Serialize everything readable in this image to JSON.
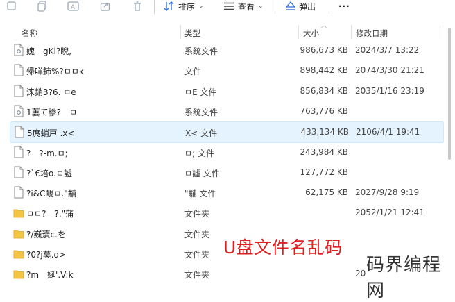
{
  "toolbar": {
    "sort_label": "排序",
    "view_label": "查看",
    "eject_label": "弹出",
    "more_label": "···"
  },
  "columns": {
    "name": "名称",
    "type": "类型",
    "size": "大小",
    "modified": "修改日期"
  },
  "files": [
    {
      "name": "媿　gKl?睨,",
      "type": "系统文件",
      "size": "986,673 KB",
      "date": "2024/3/7 13:22",
      "icon": "system-file-icon"
    },
    {
      "name": "帰咩鈰%?ㅁㅁk",
      "type": "文件",
      "size": "898,442 KB",
      "date": "2074/3/30 21:21",
      "icon": "file-icon"
    },
    {
      "name": "涞銷3?6. ㅁe",
      "type": "ㅁE 文件",
      "size": "856,834 KB",
      "date": "2035/1/16 23:19",
      "icon": "file-icon"
    },
    {
      "name": "1萋て椮?　ㅁ",
      "type": "系统文件",
      "size": "763,776 KB",
      "date": "",
      "icon": "system-file-icon"
    },
    {
      "name": "5庹蛸戸 .x<",
      "type": "X< 文件",
      "size": "433,134 KB",
      "date": "2106/4/1 19:41",
      "icon": "file-icon",
      "selected": true
    },
    {
      "name": "?　?-m.ㅁ;",
      "type": "ㅁ; 文件",
      "size": "243,984 KB",
      "date": "",
      "icon": "file-icon"
    },
    {
      "name": "?`€培o.ㅁ譃",
      "type": "ㅁ譃 文件",
      "size": "127,772 KB",
      "date": "",
      "icon": "file-icon"
    },
    {
      "name": "?i&C靦ㅁ.\"黼",
      "type": "\"黼 文件",
      "size": "62,175 KB",
      "date": "2027/9/28 9:19",
      "icon": "file-icon"
    },
    {
      "name": "ㅁㅁ?　?.\"蒲",
      "type": "文件夹",
      "size": "",
      "date": "2052/1/21 12:41",
      "icon": "folder-icon"
    },
    {
      "name": "?/巍瀆c.を",
      "type": "文件夹",
      "size": "",
      "date": "",
      "icon": "folder-icon"
    },
    {
      "name": "?0?j茣.d>",
      "type": "文件夹",
      "size": "",
      "date": "",
      "icon": "folder-icon"
    },
    {
      "name": "?m　娫'.V:k",
      "type": "文件夹",
      "size": "",
      "date": "20",
      "icon": "folder-icon"
    }
  ],
  "caption": "U盘文件名乱码",
  "watermark": "码界编程网",
  "colors": {
    "selection_bg": "#e5f3ff",
    "caption_red": "#e02020",
    "folder_yellow": "#f4c542",
    "icon_blue": "#2f6fd6"
  }
}
